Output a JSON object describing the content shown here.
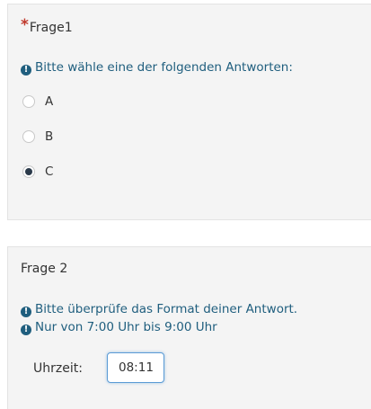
{
  "question1": {
    "required_mark": "*",
    "title": "Frage1",
    "hint": "Bitte wähle eine der folgenden Antworten:",
    "options": [
      {
        "label": "A",
        "checked": false
      },
      {
        "label": "B",
        "checked": false
      },
      {
        "label": "C",
        "checked": true
      }
    ]
  },
  "question2": {
    "title": "Frage 2",
    "hints": [
      "Bitte überprüfe das Format deiner Antwort.",
      "Nur von 7:00 Uhr bis 9:00 Uhr"
    ],
    "field_label": "Uhrzeit:",
    "field_value": "08:11"
  },
  "icons": {
    "info": "info-icon"
  },
  "colors": {
    "hint_text": "#1f5e7e",
    "required": "#c0392b",
    "panel_bg": "#f4f4f4",
    "input_focus": "#5b9bd5"
  }
}
